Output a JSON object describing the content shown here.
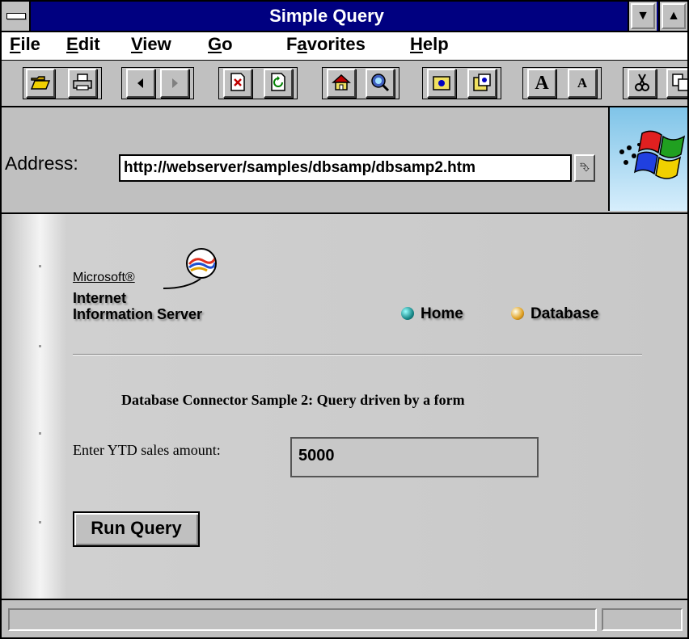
{
  "window": {
    "title": "Simple Query",
    "minimize_glyph": "▼",
    "maximize_glyph": "▲"
  },
  "menu": [
    {
      "underline": "F",
      "rest": "ile"
    },
    {
      "underline": "E",
      "rest": "dit"
    },
    {
      "underline": "V",
      "rest": "iew"
    },
    {
      "underline": "G",
      "rest": "o"
    },
    {
      "prefix": "F",
      "underline": "a",
      "rest": "vorites"
    },
    {
      "underline": "H",
      "rest": "elp"
    }
  ],
  "toolbar": {
    "icons": {
      "open": "folder-open-icon",
      "print": "printer-icon",
      "back": "back-arrow-icon",
      "forward": "forward-arrow-icon",
      "stop": "stop-icon",
      "refresh": "refresh-icon",
      "home": "home-icon",
      "search": "search-icon",
      "favorites": "favorites-folder-icon",
      "add_favorites": "add-to-favorites-icon",
      "larger_font": "larger-font-icon",
      "smaller_font": "smaller-font-icon",
      "cut": "scissors-icon",
      "copy": "copy-icon"
    },
    "font_glyph": "A"
  },
  "address": {
    "label": "Address:",
    "url": "http://webserver/samples/dbsamp/dbsamp2.htm"
  },
  "page": {
    "brand_microsoft": "Microsoft®",
    "brand_line1": "Internet",
    "brand_line2": "Information Server",
    "nav_home": "Home",
    "nav_database": "Database",
    "heading": "Database Connector Sample 2: Query driven by a form",
    "ytd_label": "Enter YTD sales amount:",
    "ytd_value": "5000",
    "run_button": "Run Query"
  },
  "colors": {
    "titlebar": "#000080",
    "chrome": "#c0c0c0",
    "home_ball": "#1a8a8a",
    "database_ball": "#e0a020"
  }
}
